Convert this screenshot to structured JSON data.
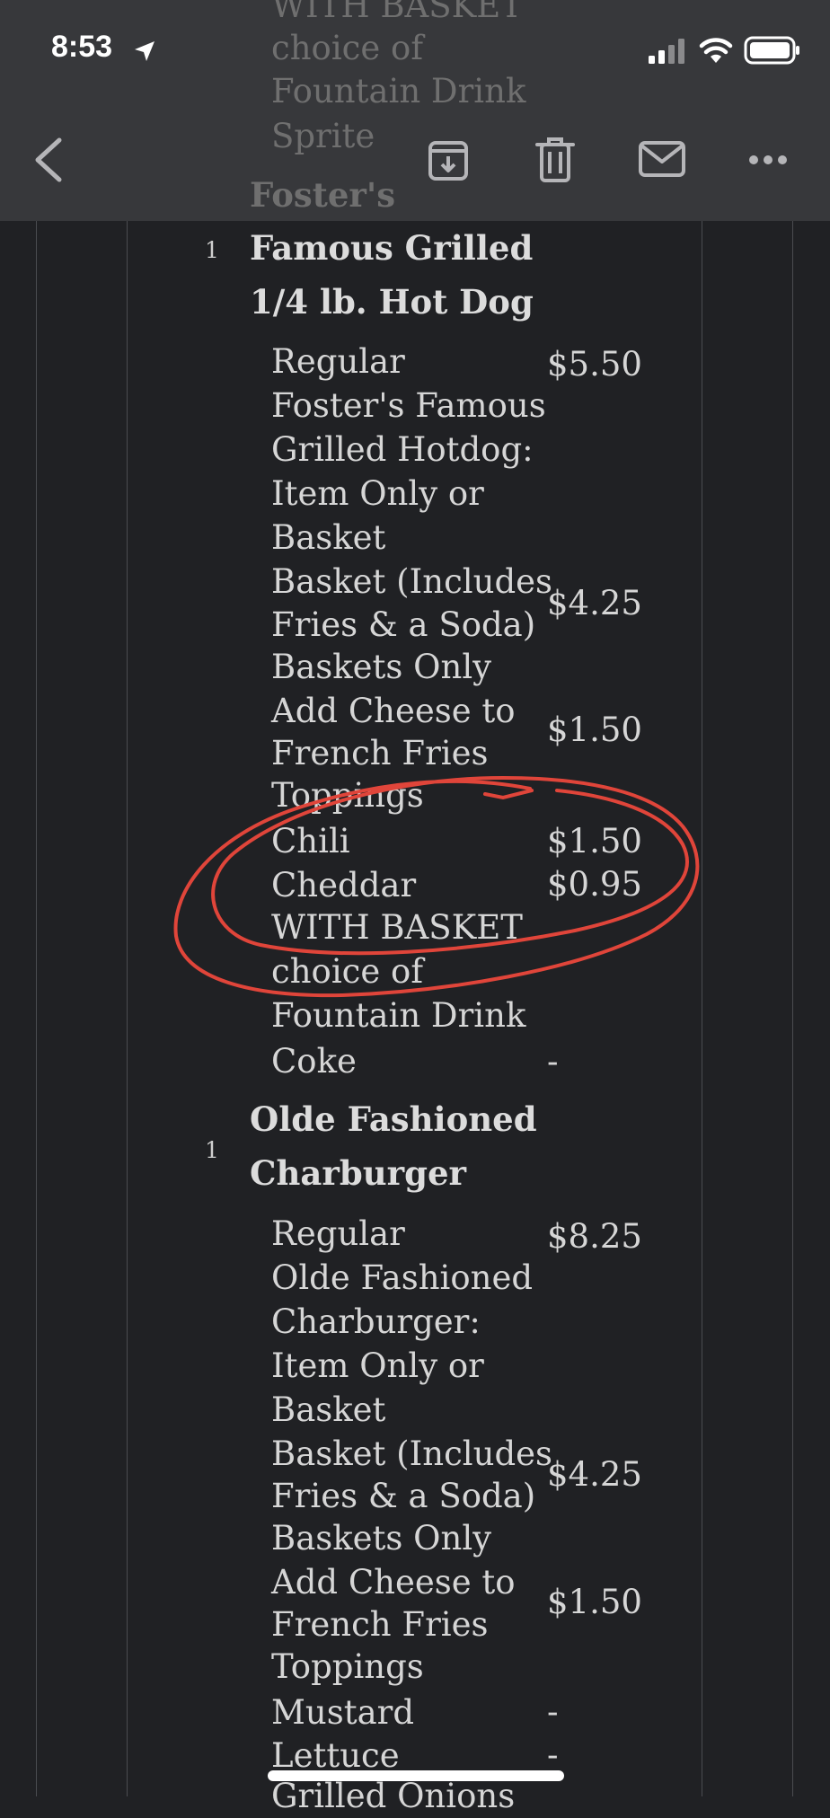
{
  "status_bar": {
    "time": "8:53"
  },
  "toolbar": {
    "back_icon": "chevron-left-icon",
    "archive_icon": "archive-icon",
    "trash_icon": "trash-icon",
    "mail_icon": "mail-icon",
    "more_icon": "ellipsis-icon"
  },
  "scrolled_under": [
    "WITH BASKET",
    "choice of",
    "Fountain Drink",
    "Sprite",
    "Foster's"
  ],
  "items": [
    {
      "qty": "1",
      "title_lines": [
        "Famous Grilled",
        "1/4 lb. Hot Dog"
      ],
      "lines": [
        "Regular",
        "Foster's Famous",
        "Grilled Hotdog:",
        "Item Only or",
        "Basket",
        "Basket (Includes",
        "Fries & a Soda)",
        "Baskets Only",
        "Add Cheese to",
        "French Fries",
        "Toppings",
        "Chili",
        "Cheddar",
        "WITH BASKET",
        "choice of",
        "Fountain Drink",
        "Coke"
      ],
      "prices": [
        "$5.50",
        "$4.25",
        "$1.50",
        "$1.50",
        "$0.95",
        "-"
      ]
    },
    {
      "qty": "1",
      "title_lines": [
        "Olde Fashioned",
        "Charburger"
      ],
      "lines": [
        "Regular",
        "Olde Fashioned",
        "Charburger:",
        "Item Only or",
        "Basket",
        "Basket (Includes",
        "Fries & a Soda)",
        "Baskets Only",
        "Add Cheese to",
        "French Fries",
        "Toppings",
        "Mustard",
        "Lettuce",
        "Grilled Onions"
      ],
      "prices": [
        "$8.25",
        "$4.25",
        "$1.50",
        "-",
        "-"
      ]
    }
  ],
  "annotation": {
    "color": "#e0453a",
    "shape": "hand-drawn-circle"
  }
}
